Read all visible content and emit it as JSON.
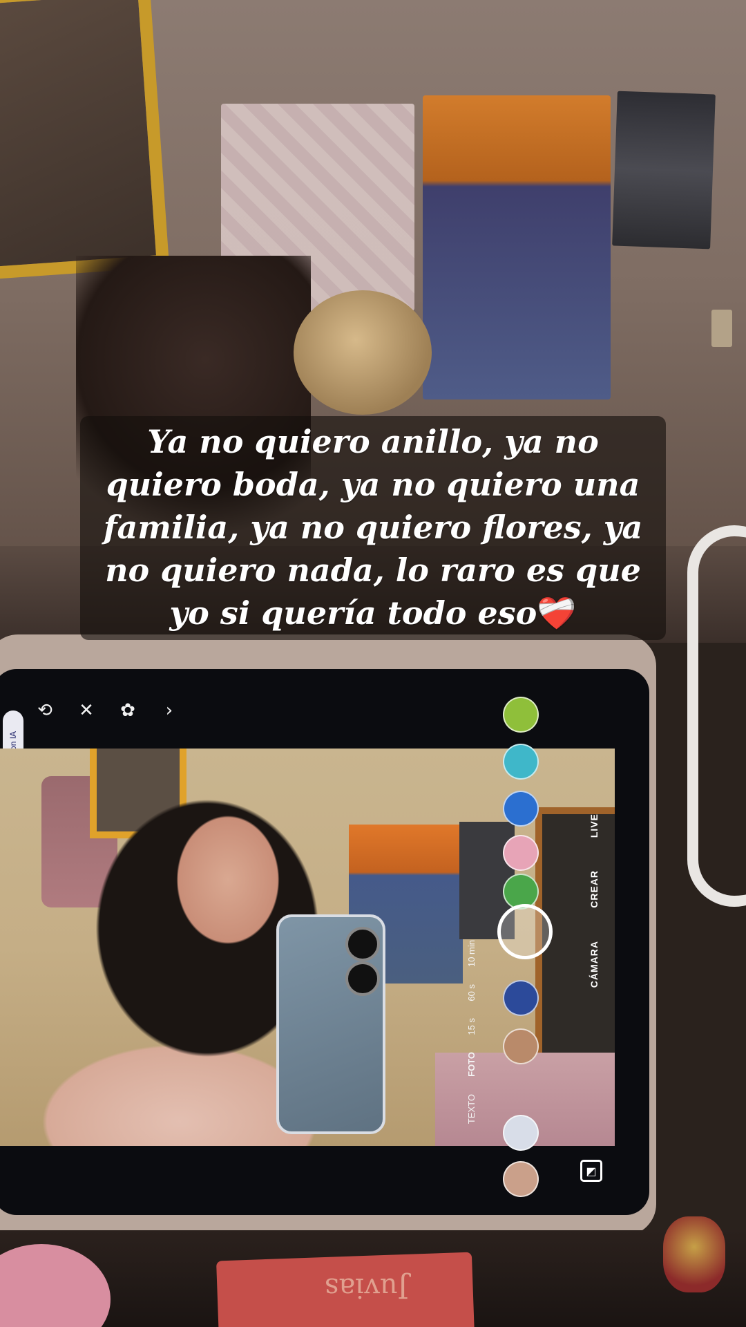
{
  "caption": {
    "text": "Ya no quiero anillo, ya no quiero boda, ya no quiero una familia, ya no quiero flores, ya no quiero nada, lo raro es que yo si quería todo eso",
    "emoji": "❤️‍🩹"
  },
  "tablet_ui": {
    "ai_label": "Reparto con IA",
    "modes": [
      "LIVE",
      "CREAR",
      "CÁMARA"
    ],
    "durations": [
      "10 min",
      "60 s",
      "15 s",
      "FOTO",
      "TEXTO"
    ],
    "active_duration": "FOTO"
  },
  "foreground": {
    "notebook_text": "Juvias"
  }
}
